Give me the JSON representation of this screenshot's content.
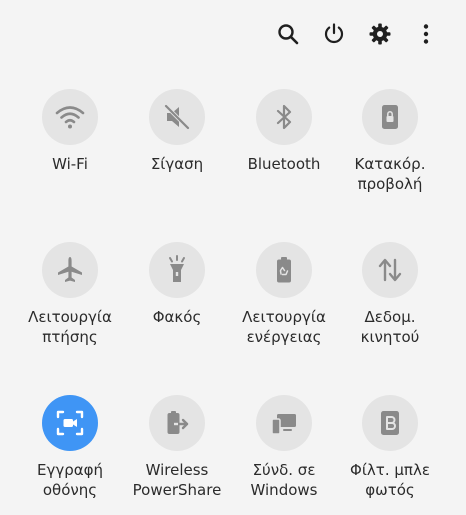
{
  "colors": {
    "background": "#f4f4f4",
    "tile_off": "#e4e4e4",
    "tile_on": "#3f95f5",
    "icon_off": "#8a8a8a",
    "icon_on": "#ffffff",
    "label": "#2b2b2b"
  },
  "toolbar": {
    "search_icon": "search-icon",
    "power_icon": "power-icon",
    "settings_icon": "gear-icon",
    "more_icon": "more-vertical-icon"
  },
  "tiles": [
    {
      "label": "Wi-Fi",
      "icon": "wifi-icon",
      "active": false
    },
    {
      "label": "Σίγαση",
      "icon": "volume-mute-icon",
      "active": false
    },
    {
      "label": "Bluetooth",
      "icon": "bluetooth-icon",
      "active": false
    },
    {
      "label": "Κατακόρ.\nπροβολή",
      "icon": "portrait-lock-icon",
      "active": false
    },
    {
      "label": "Λειτουργία\nπτήσης",
      "icon": "airplane-icon",
      "active": false
    },
    {
      "label": "Φακός",
      "icon": "flashlight-icon",
      "active": false
    },
    {
      "label": "Λειτουργία\nενέργειας",
      "icon": "power-saving-icon",
      "active": false
    },
    {
      "label": "Δεδομ.\nκινητού",
      "icon": "mobile-data-icon",
      "active": false
    },
    {
      "label": "Εγγραφή\nοθόνης",
      "icon": "screen-record-icon",
      "active": true
    },
    {
      "label": "Wireless\nPowerShare",
      "icon": "wireless-powershare-icon",
      "active": false
    },
    {
      "label": "Σύνδ. σε\nWindows",
      "icon": "link-to-windows-icon",
      "active": false
    },
    {
      "label": "Φίλτ. μπλε\nφωτός",
      "icon": "blue-light-filter-icon",
      "active": false
    }
  ]
}
